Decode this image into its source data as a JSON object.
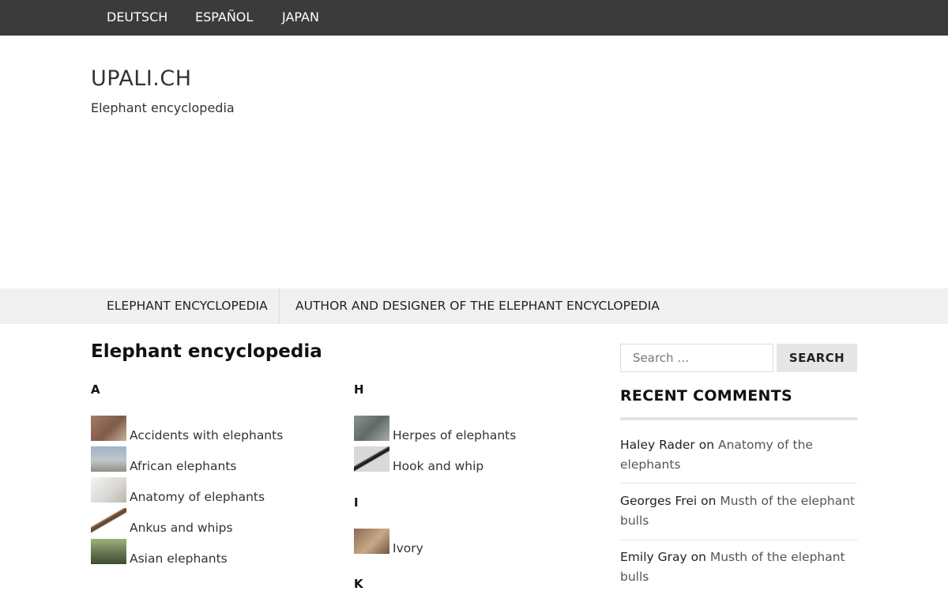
{
  "top_languages": [
    "DEUTSCH",
    "ESPAÑOL",
    "JAPAN"
  ],
  "site": {
    "title": "UPALI.CH",
    "description": "Elephant encyclopedia"
  },
  "main_nav": [
    "ELEPHANT ENCYCLOPEDIA",
    "AUTHOR AND DESIGNER OF THE ELEPHANT ENCYCLOPEDIA"
  ],
  "page_title": "Elephant encyclopedia",
  "index": {
    "A": {
      "letter": "A",
      "entries": [
        "Accidents with elephants",
        "African elephants",
        "Anatomy of elephants",
        "Ankus and whips",
        "Asian elephants"
      ]
    },
    "H": {
      "letter": "H",
      "entries": [
        "Herpes of elephants",
        "Hook and whip"
      ]
    },
    "I": {
      "letter": "I",
      "entries": [
        "Ivory"
      ]
    },
    "K": {
      "letter": "K"
    }
  },
  "search": {
    "placeholder": "Search …",
    "button_label": "SEARCH"
  },
  "recent_comments": {
    "title": "RECENT COMMENTS",
    "connector": "on",
    "items": [
      {
        "author": "Haley Rader",
        "post_line1": "Anatomy of the",
        "post_line2": "elephants"
      },
      {
        "author": "Georges Frei",
        "post_line1": "Musth of the elephant",
        "post_line2": "bulls"
      },
      {
        "author": "Emily Gray",
        "post_line1": "Musth of the elephant",
        "post_line2": "bulls"
      }
    ]
  }
}
